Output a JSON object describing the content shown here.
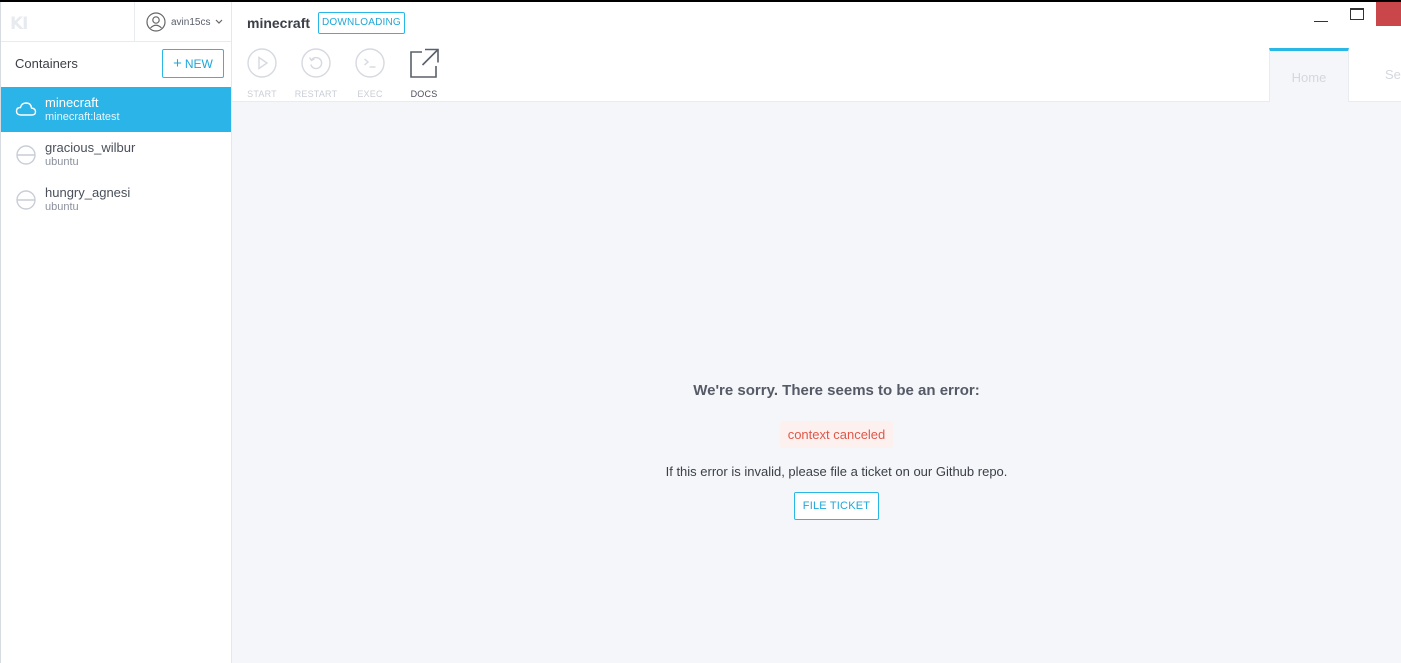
{
  "app": {
    "logo": "KI",
    "username": "avin15cs"
  },
  "sidebar": {
    "title": "Containers",
    "new_label": "NEW",
    "items": [
      {
        "name": "minecraft",
        "image": "minecraft:latest",
        "icon": "cloud-download-icon",
        "active": true
      },
      {
        "name": "gracious_wilbur",
        "image": "ubuntu",
        "icon": "stopped-icon",
        "active": false
      },
      {
        "name": "hungry_agnesi",
        "image": "ubuntu",
        "icon": "stopped-icon",
        "active": false
      }
    ]
  },
  "header": {
    "container_name": "minecraft",
    "status": "DOWNLOADING",
    "tools": [
      {
        "label": "START",
        "icon": "play-icon"
      },
      {
        "label": "RESTART",
        "icon": "restart-icon"
      },
      {
        "label": "EXEC",
        "icon": "terminal-icon"
      },
      {
        "label": "DOCS",
        "icon": "external-link-icon"
      }
    ],
    "tabs": {
      "home": "Home",
      "settings": "Settings"
    }
  },
  "error": {
    "title": "We're sorry. There seems to be an error:",
    "message": "context canceled",
    "note": "If this error is invalid, please file a ticket on our Github repo.",
    "button": "FILE TICKET"
  },
  "colors": {
    "accent": "#2ab4e8",
    "error": "#e0574a",
    "close": "#c9474b"
  }
}
